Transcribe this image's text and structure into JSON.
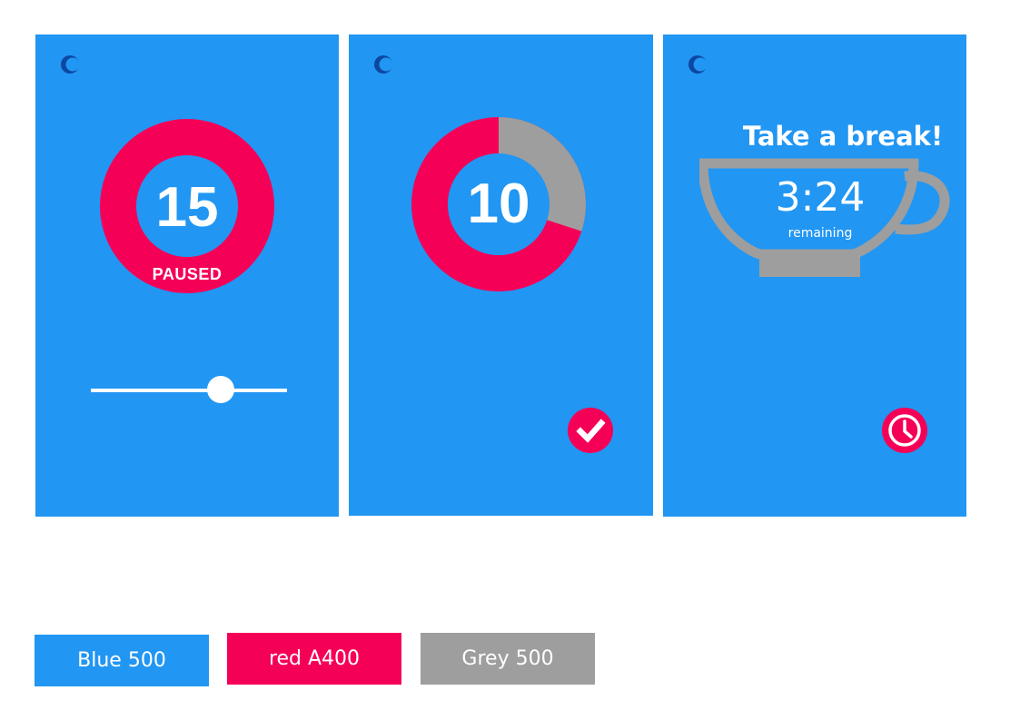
{
  "colors": {
    "blue": "#2196F3",
    "red": "#F50057",
    "grey": "#9E9E9E",
    "moon": "#0D47A1",
    "white": "#FFFFFF"
  },
  "screens": [
    {
      "icon": "night-mode-icon",
      "count": "15",
      "status": "PAUSED",
      "slider_value": 0.66
    },
    {
      "icon": "night-mode-icon",
      "count": "10",
      "progress_elapsed_fraction": 0.3,
      "action_icon": "checkmark-icon"
    },
    {
      "icon": "night-mode-icon",
      "title": "Take a break!",
      "timer": "3:24",
      "timer_label": "remaining",
      "cup_icon": "coffee-cup-icon",
      "action_icon": "clock-icon"
    }
  ],
  "swatches": [
    {
      "label": "Blue 500",
      "color": "#2196F3"
    },
    {
      "label": "red A400",
      "color": "#F50057"
    },
    {
      "label": "Grey 500",
      "color": "#9E9E9E"
    }
  ]
}
